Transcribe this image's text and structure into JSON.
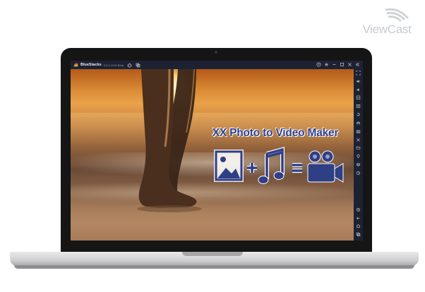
{
  "watermark": {
    "text": "ViewCast"
  },
  "emulator": {
    "name": "BlueStacks",
    "version": "5.0.0.1026 Beta"
  },
  "app": {
    "title": "XX Photo to Video Maker",
    "formula": [
      "photo-icon",
      "plus",
      "music-note-icon",
      "equals",
      "video-camera-icon"
    ]
  },
  "colors": {
    "title_blue": "#2f3f86",
    "emulator_bar": "#1d2232"
  }
}
